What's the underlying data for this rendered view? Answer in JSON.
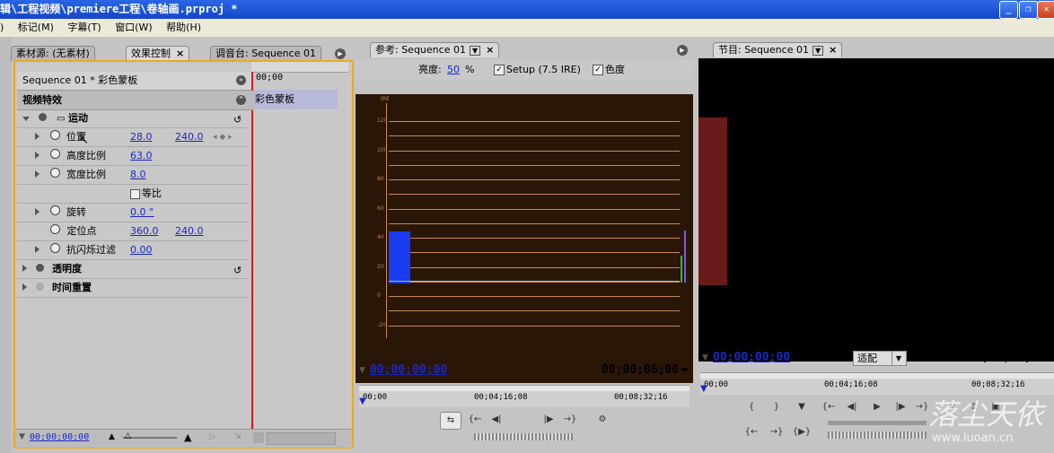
{
  "title": "辑\\工程视频\\premiere工程\\卷轴画.prproj *",
  "window_buttons": {
    "minimize": "_",
    "restore": "❐",
    "close": "✕"
  },
  "menu": [
    "标记(M)",
    "字幕(T)",
    "窗口(W)",
    "帮助(H)"
  ],
  "menu_lead": ")",
  "left_panel": {
    "tabs": [
      {
        "label": "素材源: (无素材)"
      },
      {
        "label": "效果控制",
        "close": "×"
      },
      {
        "label": "调音台: Sequence 01"
      }
    ],
    "clip_header": "Sequence 01 * 彩色蒙板",
    "clip_name_timeline": "彩色蒙板",
    "ruler_time": "00;00",
    "section_video": "视频特效",
    "motion": "运动",
    "params": [
      {
        "label": "位置",
        "v1": "28.0",
        "v2": "240.0"
      },
      {
        "label": "高度比例",
        "v1": "63.0"
      },
      {
        "label": "宽度比例",
        "v1": "8.0"
      },
      {
        "label": "等比"
      },
      {
        "label": "旋转",
        "v1": "0.0 °"
      },
      {
        "label": "定位点",
        "v1": "360.0",
        "v2": "240.0"
      },
      {
        "label": "抗闪烁过滤",
        "v1": "0.00"
      }
    ],
    "opacity": "透明度",
    "time_remap": "时间重置",
    "footer_time": "00;00;00;00"
  },
  "reference_monitor": {
    "tab": "参考: Sequence 01",
    "brightness_label": "亮度:",
    "brightness_value": "50",
    "brightness_unit": "%",
    "setup_label": "Setup (7.5 IRE)",
    "chroma_label": "色度",
    "scope_unit": "IRE",
    "scope_ticks": [
      "120",
      "100",
      "80",
      "60",
      "40",
      "20",
      "0",
      "-20"
    ],
    "current_time": "00;00;00;00",
    "duration": "00;00;06;00",
    "ruler": [
      "00;00",
      "00;04;16;08",
      "00;08;32;16"
    ]
  },
  "program_monitor": {
    "tab": "节目: Sequence 01",
    "current_time": "00;00;00;00",
    "fit_label": "适配",
    "duration": "00;00;06;00",
    "ruler": [
      "00;00",
      "00;04;16;08",
      "00;08;32;16"
    ]
  },
  "watermark": {
    "brand": "落尘天依",
    "url": "www.luoan.cn"
  },
  "colors": {
    "accent_blue": "#1a28c8",
    "panel_border_orange": "#f0a818",
    "scope_bg": "#2a1606",
    "clip_red": "#6a1a1a"
  }
}
